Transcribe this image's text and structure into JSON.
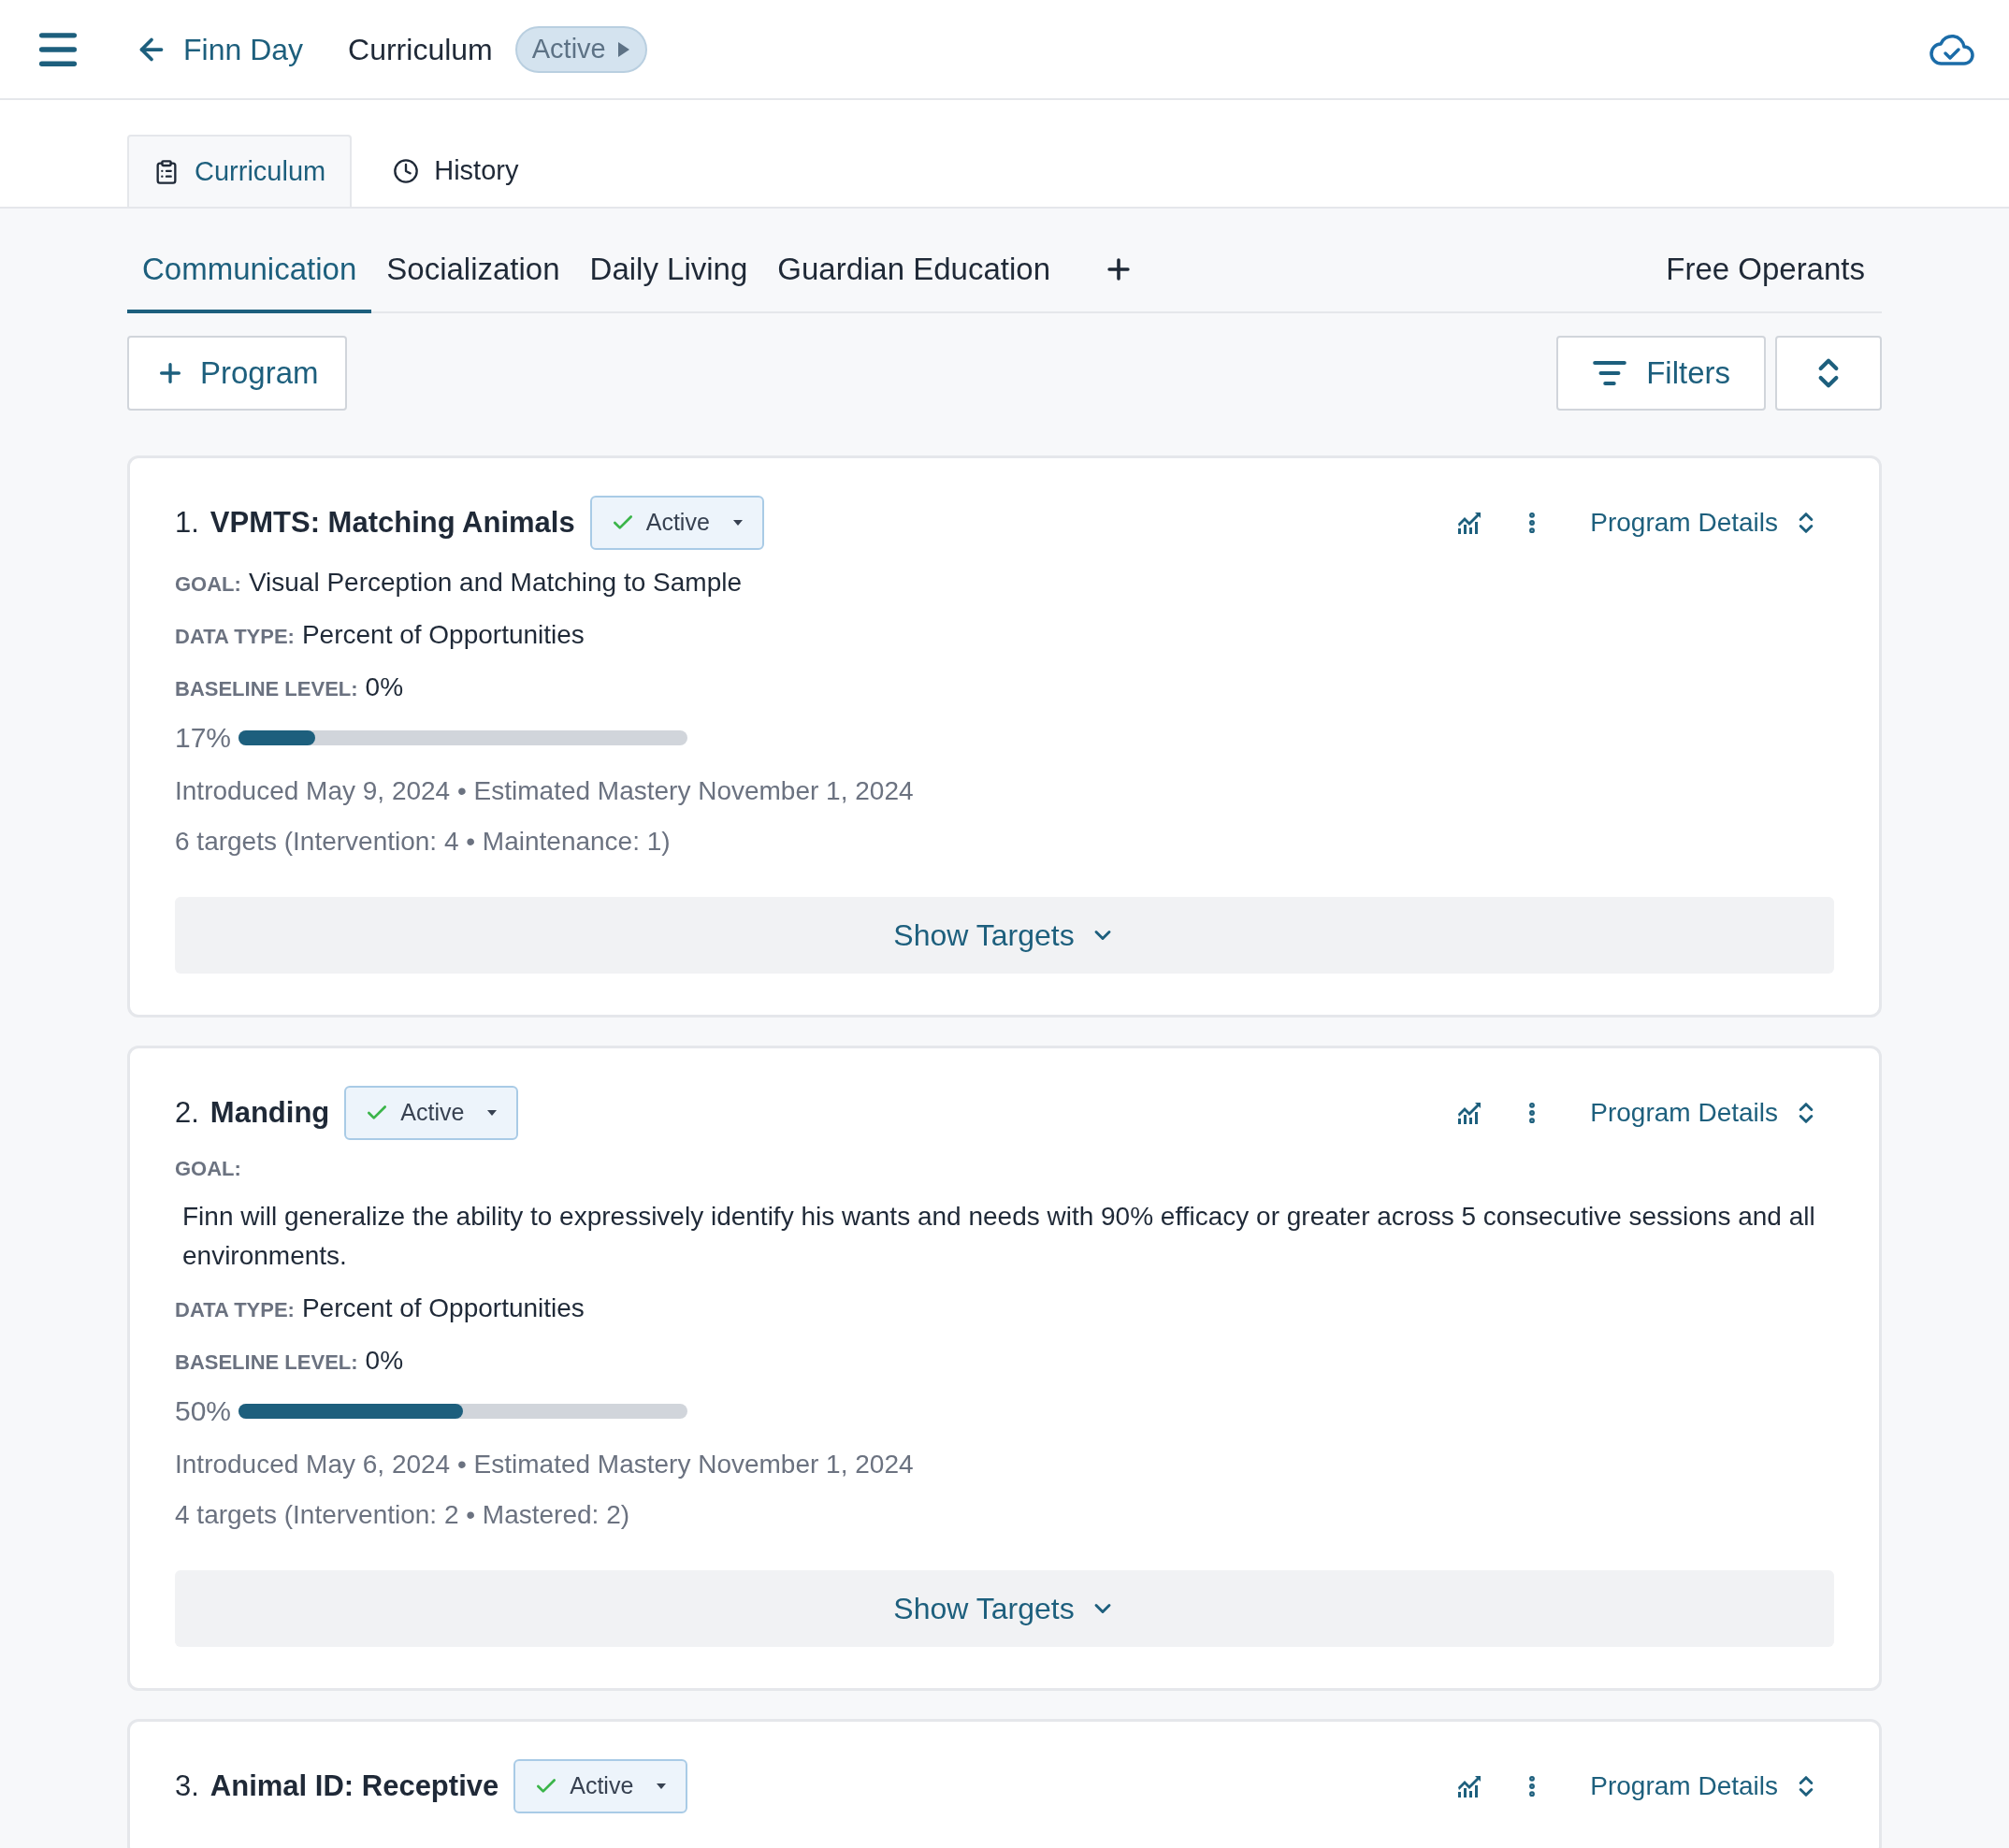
{
  "header": {
    "back_label": "Finn Day",
    "title": "Curriculum",
    "status": "Active"
  },
  "view_tabs": [
    {
      "label": "Curriculum",
      "selected": true
    },
    {
      "label": "History",
      "selected": false
    }
  ],
  "category_tabs": [
    {
      "label": "Communication",
      "selected": true
    },
    {
      "label": "Socialization",
      "selected": false
    },
    {
      "label": "Daily Living",
      "selected": false
    },
    {
      "label": "Guardian Education",
      "selected": false
    }
  ],
  "extra_tab": "Free Operants",
  "toolbar": {
    "add_label": "Program",
    "filters_label": "Filters"
  },
  "programs": [
    {
      "number": "1.",
      "title": "VPMTS: Matching Animals",
      "status": "Active",
      "details_label": "Program Details",
      "fields": [
        {
          "kind": "inline",
          "label": "GOAL:",
          "value": "Visual Perception and Matching to Sample"
        },
        {
          "kind": "inline",
          "label": "DATA TYPE:",
          "value": "Percent of Opportunities"
        },
        {
          "kind": "inline",
          "label": "BASELINE LEVEL:",
          "value": "0%"
        }
      ],
      "progress": {
        "reading": "17%",
        "level": 0.17
      },
      "dates": "Introduced May 9, 2024 • Estimated Mastery November 1, 2024",
      "targets": "6 targets (Intervention: 4 • Maintenance: 1)",
      "show_targets": "Show Targets"
    },
    {
      "number": "2.",
      "title": "Manding",
      "status": "Active",
      "details_label": "Program Details",
      "fields": [
        {
          "kind": "block",
          "label": "GOAL:",
          "value": "Finn will generalize the ability to expressively identify his wants and needs with 90% efficacy or greater across 5 consecutive sessions and all environments."
        },
        {
          "kind": "inline",
          "label": "DATA TYPE:",
          "value": "Percent of Opportunities"
        },
        {
          "kind": "inline",
          "label": "BASELINE LEVEL:",
          "value": "0%"
        }
      ],
      "progress": {
        "reading": "50%",
        "level": 0.5
      },
      "dates": "Introduced May 6, 2024 • Estimated Mastery November 1, 2024",
      "targets": "4 targets (Intervention: 2 • Mastered: 2)",
      "show_targets": "Show Targets"
    },
    {
      "number": "3.",
      "title": "Animal ID: Receptive",
      "status": "Active",
      "details_label": "Program Details"
    }
  ]
}
